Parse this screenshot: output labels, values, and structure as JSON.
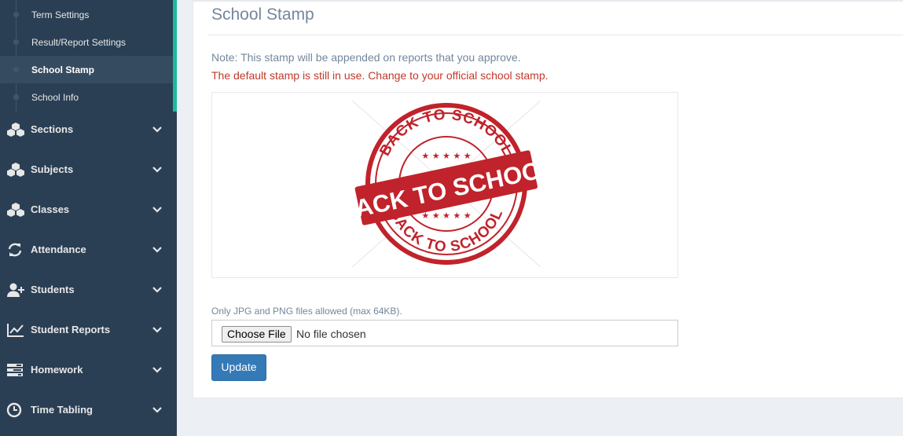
{
  "sidebar": {
    "submenu": [
      {
        "label": "Term Settings"
      },
      {
        "label": "Result/Report Settings"
      },
      {
        "label": "School Stamp",
        "active": true
      },
      {
        "label": "School Info"
      }
    ],
    "menu": [
      {
        "label": "Sections",
        "icon": "cubes-icon"
      },
      {
        "label": "Subjects",
        "icon": "cubes-icon"
      },
      {
        "label": "Classes",
        "icon": "cubes-icon"
      },
      {
        "label": "Attendance",
        "icon": "refresh-icon"
      },
      {
        "label": "Students",
        "icon": "user-plus-icon"
      },
      {
        "label": "Student Reports",
        "icon": "line-chart-icon"
      },
      {
        "label": "Homework",
        "icon": "tasks-icon"
      },
      {
        "label": "Time Tabling",
        "icon": "clock-icon"
      }
    ]
  },
  "main": {
    "title": "School Stamp",
    "note": "Note: This stamp will be appended on reports that you approve.",
    "warning": "The default stamp is still in use. Change to your official school stamp.",
    "stamp": {
      "top_text": "BACK TO SCHOOL",
      "banner_text": "BACK TO SCHOOL",
      "bottom_text": "BACK TO SCHOOL"
    },
    "file_hint": "Only JPG and PNG files allowed (max 64KB).",
    "choose_file_label": "Choose File",
    "no_file_text": "No file chosen",
    "update_label": "Update"
  },
  "colors": {
    "sidebar_bg": "#2a3f54",
    "accent": "#1abb9c",
    "warning": "#c0392b",
    "primary_button": "#337ab7",
    "stamp_red": "#c0232b"
  }
}
